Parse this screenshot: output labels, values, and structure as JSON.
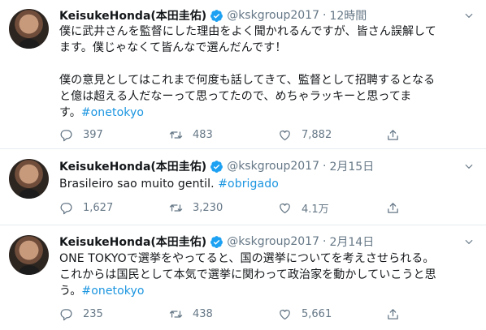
{
  "tweets": [
    {
      "name": "KeisukeHonda(本田圭佑)",
      "handle": "@kskgroup2017",
      "separator": "·",
      "time": "12時間",
      "line1": "僕に武井さんを監督にした理由をよく聞かれるんですが、皆さん誤解して",
      "line2": "ます。僕じゃなくて皆んなで選んだんです！",
      "line3": "僕の意見としてはこれまで何度も話してきて、監督として招聘するとなる",
      "line4": "と億は超える人だなーって思ってたので、めちゃラッキーと思ってま",
      "line5_prefix": "す。",
      "hashtag": "#onetokyo",
      "replies": "397",
      "retweets": "483",
      "likes": "7,882"
    },
    {
      "name": "KeisukeHonda(本田圭佑)",
      "handle": "@kskgroup2017",
      "separator": "·",
      "time": "2月15日",
      "text": "Brasileiro sao muito gentil. ",
      "hashtag": "#obrigado",
      "replies": "1,627",
      "retweets": "3,230",
      "likes": "4.1万"
    },
    {
      "name": "KeisukeHonda(本田圭佑)",
      "handle": "@kskgroup2017",
      "separator": "·",
      "time": "2月14日",
      "line1": "ONE TOKYOで選挙をやってると、国の選挙についてを考えさせられる。",
      "line2": "これからは国民として本気で選挙に関わって政治家を動かしていこうと思",
      "line3_prefix": "う。",
      "hashtag": "#onetokyo",
      "replies": "235",
      "retweets": "438",
      "likes": "5,661"
    }
  ],
  "colors": {
    "link": "#1b95e0",
    "muted": "#657786",
    "verified": "#1da1f2",
    "divider": "#e6ecf0"
  },
  "icons": [
    "verified-badge-icon",
    "chevron-down-icon",
    "reply-icon",
    "retweet-icon",
    "like-icon",
    "share-icon"
  ]
}
